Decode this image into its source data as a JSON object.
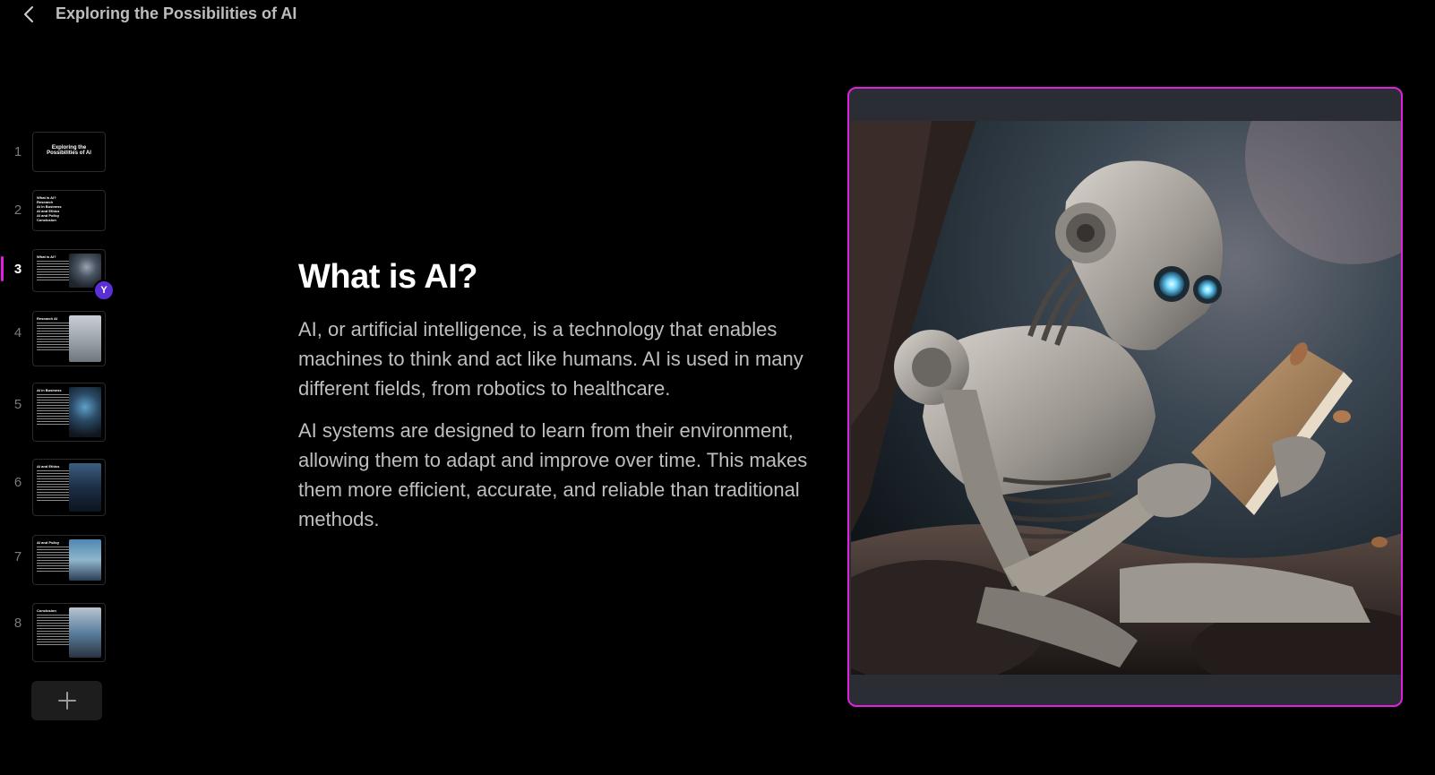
{
  "header": {
    "title": "Exploring the Possibilities of AI",
    "back_icon": "chevron-left-icon"
  },
  "sidebar": {
    "active_index": 3,
    "slides": [
      {
        "number": "1",
        "thumb_title": "Exploring the Possibilities of AI"
      },
      {
        "number": "2",
        "thumb_lines": [
          "What is AI?",
          "Research",
          "AI in Business",
          "AI and Ethics",
          "AI and Policy",
          "Conclusion"
        ]
      },
      {
        "number": "3",
        "thumb_title": "What is AI?"
      },
      {
        "number": "4",
        "thumb_title": "Research AI"
      },
      {
        "number": "5",
        "thumb_title": "AI in Business"
      },
      {
        "number": "6",
        "thumb_title": "AI and Ethics"
      },
      {
        "number": "7",
        "thumb_title": "AI and Policy"
      },
      {
        "number": "8",
        "thumb_title": "Conclusion"
      }
    ],
    "avatar_initial": "Y",
    "add_icon": "plus-icon"
  },
  "slide": {
    "heading": "What is AI?",
    "paragraphs": [
      "AI, or artificial intelligence, is a technology that enables machines to think and act like humans. AI is used in many different fields, from robotics to healthcare.",
      "AI systems are designed to learn from their environment, allowing them to adapt and improve over time. This makes them more efficient, accurate, and reliable than traditional methods."
    ],
    "image_subject": "robot-reading-book-image"
  },
  "colors": {
    "background": "#000000",
    "accent": "#e020e0",
    "avatar": "#5b2fd6",
    "body_text": "#bfbfbf",
    "muted_text": "#7a7a7a"
  }
}
